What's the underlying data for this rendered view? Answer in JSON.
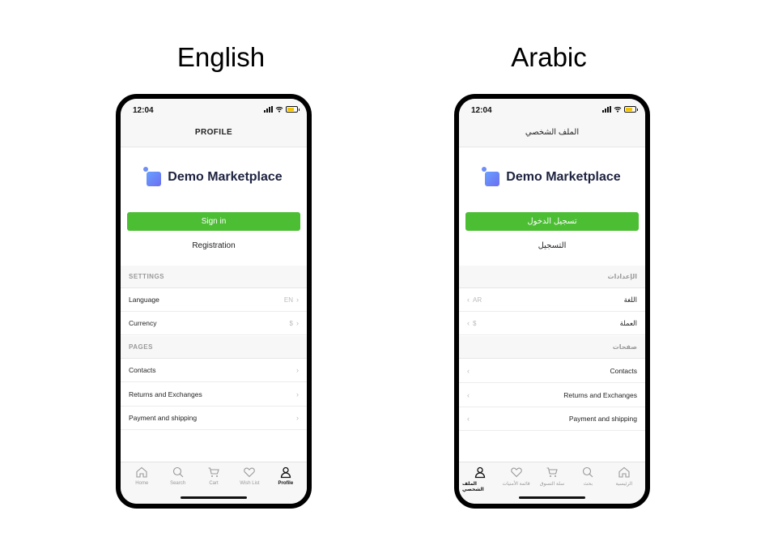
{
  "headings": {
    "english": "English",
    "arabic": "Arabic"
  },
  "phones": {
    "en": {
      "status": {
        "time": "12:04"
      },
      "title": "PROFILE",
      "logo": "Demo Marketplace",
      "sign_in": "Sign in",
      "registration": "Registration",
      "settings_header": "SETTINGS",
      "language": {
        "label": "Language",
        "value": "EN",
        "chevron": "›"
      },
      "currency": {
        "label": "Currency",
        "value": "$",
        "chevron": "›"
      },
      "pages_header": "PAGES",
      "pages": [
        {
          "label": "Contacts",
          "chevron": "›"
        },
        {
          "label": "Returns and Exchanges",
          "chevron": "›"
        },
        {
          "label": "Payment and shipping",
          "chevron": "›"
        }
      ],
      "tabs": [
        {
          "label": "Home",
          "icon": "home-icon"
        },
        {
          "label": "Search",
          "icon": "search-icon"
        },
        {
          "label": "Cart",
          "icon": "cart-icon"
        },
        {
          "label": "Wish List",
          "icon": "heart-icon"
        },
        {
          "label": "Profile",
          "icon": "user-icon",
          "active": true
        }
      ]
    },
    "ar": {
      "status": {
        "time": "12:04"
      },
      "title": "الملف الشخصي",
      "logo": "Demo Marketplace",
      "sign_in": "تسجيل الدخول",
      "registration": "التسجيل",
      "settings_header": "الإعدادات",
      "language": {
        "label": "اللغة",
        "value": "AR",
        "chevron": "‹"
      },
      "currency": {
        "label": "العملة",
        "value": "$",
        "chevron": "‹"
      },
      "pages_header": "صفحات",
      "pages": [
        {
          "label": "Contacts",
          "chevron": "‹"
        },
        {
          "label": "Returns and Exchanges",
          "chevron": "‹"
        },
        {
          "label": "Payment and shipping",
          "chevron": "‹"
        }
      ],
      "tabs": [
        {
          "label": "الرئيسية",
          "icon": "home-icon"
        },
        {
          "label": "بحث",
          "icon": "search-icon"
        },
        {
          "label": "سلة التسوق",
          "icon": "cart-icon"
        },
        {
          "label": "قائمة الأمنيات",
          "icon": "heart-icon"
        },
        {
          "label": "الملف الشخصي",
          "icon": "user-icon",
          "active": true
        }
      ]
    }
  },
  "colors": {
    "accent": "#4cbe34",
    "logo_text": "#1e2340",
    "muted": "#999999"
  }
}
